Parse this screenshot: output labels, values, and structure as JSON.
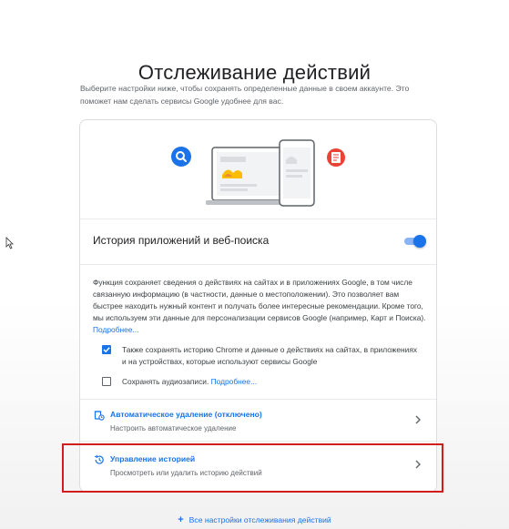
{
  "page": {
    "title": "Отслеживание действий",
    "subtitle": "Выберите настройки ниже, чтобы сохранять определенные данные в своем аккаунте. Это поможет нам сделать сервисы Google удобнее для вас."
  },
  "activity": {
    "toggle_label": "История приложений и веб-поиска",
    "toggle_on": true,
    "description": "Функция сохраняет сведения о действиях на сайтах и в приложениях Google, в том числе связанную информацию (в частности, данные о местоположении). Это позволяет вам быстрее находить нужный контент и получать более интересные рекомендации. Кроме того, мы используем эти данные для персонализации сервисов Google (например, Карт и Поиска).",
    "more_link": "Подробнее...",
    "checkbox_chrome": {
      "label": "Также сохранять историю Chrome и данные о действиях на сайтах, в приложениях и на устройствах, которые используют сервисы Google",
      "checked": true
    },
    "checkbox_audio": {
      "label": "Сохранять аудиозаписи.",
      "link": "Подробнее...",
      "checked": false
    }
  },
  "options": [
    {
      "title": "Автоматическое удаление (отключено)",
      "subtitle": "Настроить автоматическое удаление",
      "icon": "auto-delete-icon"
    },
    {
      "title": "Управление историей",
      "subtitle": "Просмотреть или удалить историю действий",
      "icon": "history-icon"
    }
  ],
  "footer": {
    "all_settings_link": "Все настройки отслеживания действий"
  },
  "colors": {
    "accent": "#1a73e8",
    "highlight": "#d21d1d",
    "search_badge": "#1a73e8",
    "doc_badge": "#ea4335"
  }
}
